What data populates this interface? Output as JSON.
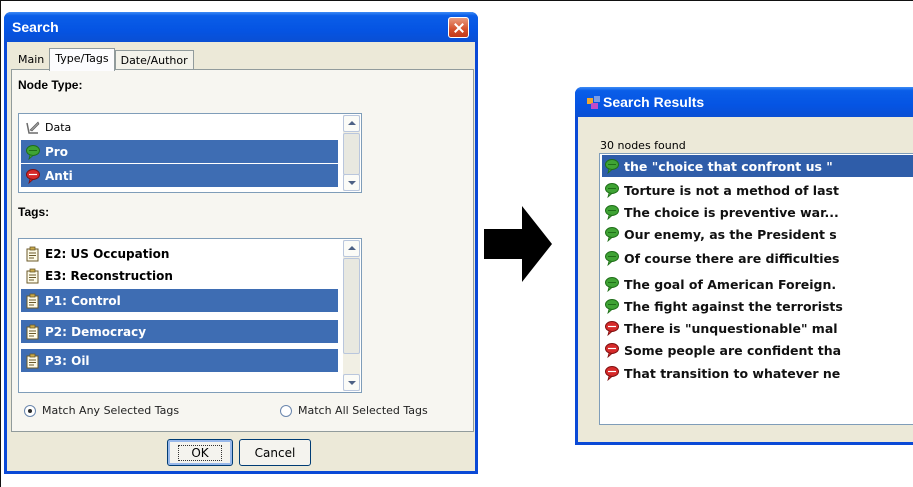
{
  "search_dialog": {
    "title": "Search",
    "tabs": [
      "Main",
      "Type/Tags",
      "Date/Author"
    ],
    "active_tab": "Type/Tags",
    "node_type_label": "Node Type:",
    "node_types": [
      {
        "label": "Data",
        "icon": "data-icon",
        "selected": false
      },
      {
        "label": "Pro",
        "icon": "pro-icon",
        "selected": true
      },
      {
        "label": "Anti",
        "icon": "anti-icon",
        "selected": true
      }
    ],
    "tags_label": "Tags:",
    "tags": [
      {
        "label": "E2: US Occupation",
        "icon": "tag-icon",
        "selected": false
      },
      {
        "label": "E3: Reconstruction",
        "icon": "tag-icon",
        "selected": false
      },
      {
        "label": "P1: Control",
        "icon": "tag-icon",
        "selected": true
      },
      {
        "label": "P2: Democracy",
        "icon": "tag-icon",
        "selected": true
      },
      {
        "label": "P3: Oil",
        "icon": "tag-icon",
        "selected": true
      }
    ],
    "match_any_label": "Match Any Selected Tags",
    "match_all_label": "Match All Selected Tags",
    "match_mode": "any",
    "ok_label": "OK",
    "cancel_label": "Cancel"
  },
  "results_window": {
    "title": "Search Results",
    "count_text": "30 nodes found",
    "results": [
      {
        "text": "the \"choice that confront us \"",
        "type": "pro",
        "selected": true
      },
      {
        "text": "Torture is not a method of last",
        "type": "pro",
        "selected": false
      },
      {
        "text": "The choice is preventive war...",
        "type": "pro",
        "selected": false
      },
      {
        "text": "Our enemy, as the President s",
        "type": "pro",
        "selected": false
      },
      {
        "text": "Of course there are difficulties",
        "type": "pro",
        "selected": false
      },
      {
        "text": "The goal of American Foreign.",
        "type": "pro",
        "selected": false
      },
      {
        "text": "The fight against the terrorists",
        "type": "pro",
        "selected": false
      },
      {
        "text": "There is \"unquestionable\" mal",
        "type": "anti",
        "selected": false
      },
      {
        "text": "Some people are confident tha",
        "type": "anti",
        "selected": false
      },
      {
        "text": "That transition to whatever ne",
        "type": "anti",
        "selected": false
      }
    ]
  },
  "colors": {
    "titlebar": "#0554e3",
    "selection": "#3e6db3",
    "pro_green": "#3fa334",
    "anti_red": "#d62a2a"
  }
}
